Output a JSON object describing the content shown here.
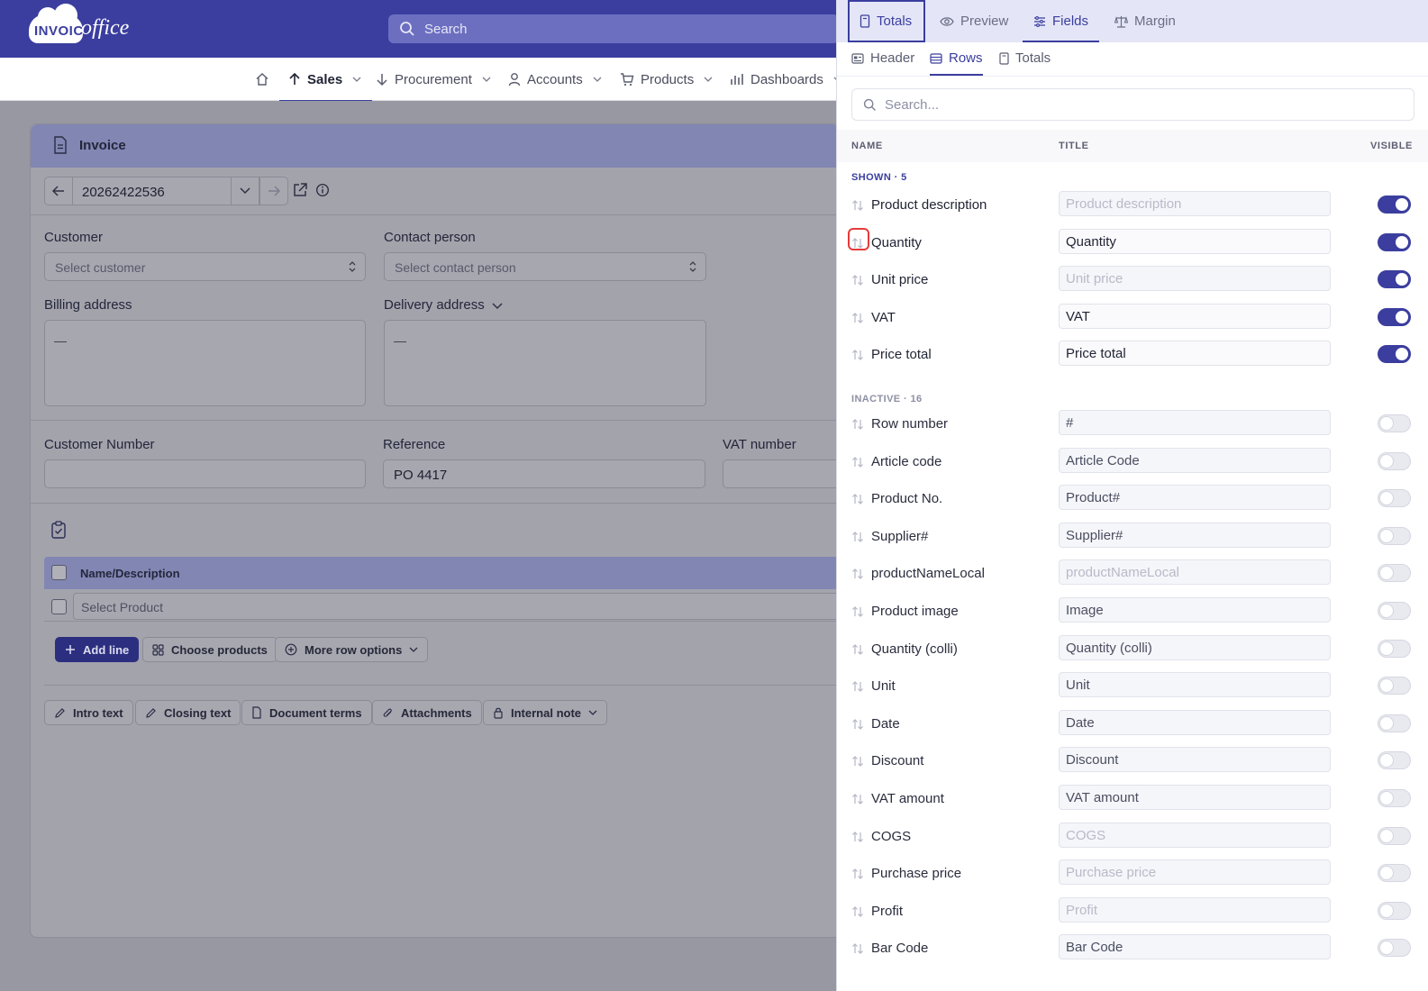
{
  "header": {
    "logo_word1": "INVOICE",
    "logo_word2": "office",
    "search_placeholder": "Search"
  },
  "nav": {
    "items": [
      {
        "label": "Sales",
        "icon": "arrow-up-icon",
        "active": true
      },
      {
        "label": "Procurement",
        "icon": "arrow-down-icon"
      },
      {
        "label": "Accounts",
        "icon": "user-icon"
      },
      {
        "label": "Products",
        "icon": "cart-icon"
      },
      {
        "label": "Dashboards",
        "icon": "bar-chart-icon"
      }
    ]
  },
  "invoice": {
    "title": "Invoice",
    "number": "20262422536",
    "customer_label": "Customer",
    "customer_placeholder": "Select customer",
    "contact_label": "Contact person",
    "contact_placeholder": "Select contact person",
    "billing_label": "Billing address",
    "billing_value": "—",
    "delivery_label": "Delivery address",
    "delivery_value": "—",
    "customer_number_label": "Customer Number",
    "customer_number_value": "",
    "reference_label": "Reference",
    "reference_value": "PO 4417",
    "vat_number_label": "VAT number",
    "vat_number_value": "",
    "table_header": "Name/Description",
    "select_product_placeholder": "Select Product",
    "add_line": "Add line",
    "choose_products": "Choose products",
    "more_row_options": "More row options",
    "intro_text": "Intro text",
    "closing_text": "Closing text",
    "document_terms": "Document terms",
    "attachments": "Attachments",
    "internal_note": "Internal note"
  },
  "panel": {
    "tabs": [
      {
        "label": "Totals",
        "icon": "document-icon"
      },
      {
        "label": "Preview",
        "icon": "eye-icon"
      },
      {
        "label": "Fields",
        "icon": "sliders-icon",
        "selected": true
      },
      {
        "label": "Margin",
        "icon": "scale-icon"
      }
    ],
    "subtabs": [
      {
        "label": "Header",
        "icon": "header-card-icon"
      },
      {
        "label": "Rows",
        "icon": "table-icon",
        "selected": true
      },
      {
        "label": "Totals",
        "icon": "document-icon"
      }
    ],
    "search_placeholder": "Search...",
    "col_name": "NAME",
    "col_title": "TITLE",
    "col_visible": "VISIBLE",
    "shown_label": "SHOWN · 5",
    "inactive_label": "INACTIVE · 16",
    "shown": [
      {
        "name": "Product description",
        "title": "",
        "placeholder": "Product description",
        "visible": true
      },
      {
        "name": "Quantity",
        "title": "Quantity",
        "placeholder": "",
        "visible": true
      },
      {
        "name": "Unit price",
        "title": "",
        "placeholder": "Unit price",
        "visible": true
      },
      {
        "name": "VAT",
        "title": "VAT",
        "placeholder": "",
        "visible": true
      },
      {
        "name": "Price total",
        "title": "Price total",
        "placeholder": "",
        "visible": true
      }
    ],
    "inactive": [
      {
        "name": "Row number",
        "title": "#",
        "placeholder": "",
        "visible": false
      },
      {
        "name": "Article code",
        "title": "Article Code",
        "placeholder": "",
        "visible": false
      },
      {
        "name": "Product No.",
        "title": "Product#",
        "placeholder": "",
        "visible": false
      },
      {
        "name": "Supplier#",
        "title": "Supplier#",
        "placeholder": "",
        "visible": false
      },
      {
        "name": "productNameLocal",
        "title": "",
        "placeholder": "productNameLocal",
        "visible": false
      },
      {
        "name": "Product image",
        "title": "Image",
        "placeholder": "",
        "visible": false
      },
      {
        "name": "Quantity (colli)",
        "title": "Quantity (colli)",
        "placeholder": "",
        "visible": false
      },
      {
        "name": "Unit",
        "title": "Unit",
        "placeholder": "",
        "visible": false
      },
      {
        "name": "Date",
        "title": "Date",
        "placeholder": "",
        "visible": false
      },
      {
        "name": "Discount",
        "title": "Discount",
        "placeholder": "",
        "visible": false
      },
      {
        "name": "VAT amount",
        "title": "VAT amount",
        "placeholder": "",
        "visible": false
      },
      {
        "name": "COGS",
        "title": "",
        "placeholder": "COGS",
        "visible": false
      },
      {
        "name": "Purchase price",
        "title": "",
        "placeholder": "Purchase price",
        "visible": false
      },
      {
        "name": "Profit",
        "title": "",
        "placeholder": "Profit",
        "visible": false
      },
      {
        "name": "Bar Code",
        "title": "Bar Code",
        "placeholder": "",
        "visible": false
      }
    ]
  }
}
